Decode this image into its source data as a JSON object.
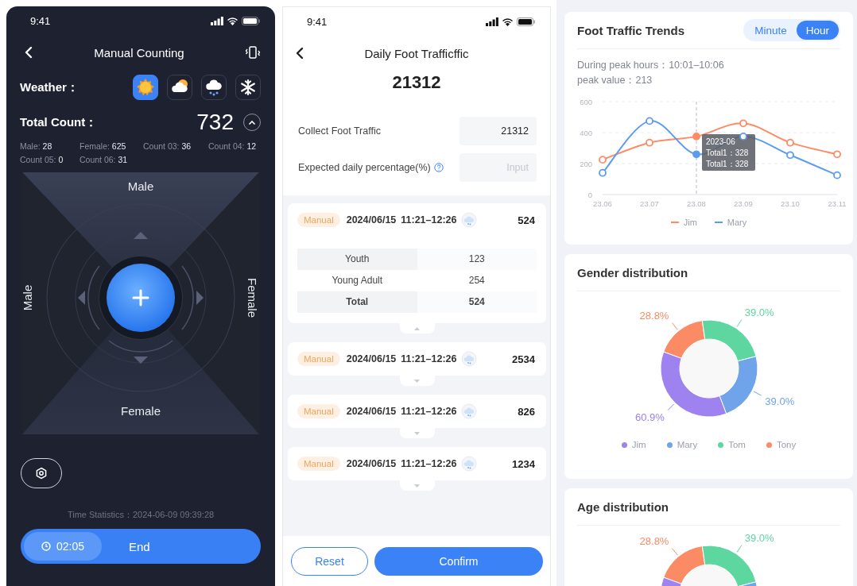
{
  "counting_screen": {
    "status_bar": {
      "time": "9:41"
    },
    "title": "Manual Counting",
    "weather_label": "Weather：",
    "weather": [
      {
        "kind": "sunny",
        "selected": true
      },
      {
        "kind": "cloudy",
        "selected": false
      },
      {
        "kind": "snow_rain",
        "selected": false
      },
      {
        "kind": "snowflake",
        "selected": false
      }
    ],
    "total_label": "Total Count：",
    "total": "732",
    "expanded": true,
    "counts": [
      "Male: **28**",
      "Female: **625**",
      "Count 03: **36**",
      "Count 04: **12**",
      "Count 05: **0**",
      "Count 06: **31**"
    ],
    "pad": {
      "top": "Male",
      "left": "Male",
      "right": "Female",
      "bottom": "Female"
    },
    "time_statistics": "Time Statistics：2024-06-09  09:39:28",
    "timer": "02:05",
    "end_button": "End"
  },
  "daily_screen": {
    "status_bar": {
      "time": "9:41"
    },
    "title": "Daily Foot Trafficffic",
    "total": "21312",
    "fields": [
      {
        "label": "Collect Foot Traffic",
        "value": "21312",
        "help": false
      },
      {
        "label": "Expected daily percentage(%)",
        "placeholder": "Input",
        "help": true
      }
    ],
    "records": [
      {
        "tag": "Manual",
        "date": "2024/06/15",
        "time": "11:21–12:26",
        "count": "524",
        "expanded": true,
        "details": [
          {
            "kind": "row",
            "label": "Youth",
            "value": "123"
          },
          {
            "kind": "row",
            "label": "Young Adult",
            "value": "254"
          },
          {
            "kind": "total",
            "label": "Total",
            "value": "524"
          }
        ]
      },
      {
        "tag": "Manual",
        "date": "2024/06/15",
        "time": "11:21–12:26",
        "count": "2534",
        "expanded": false
      },
      {
        "tag": "Manual",
        "date": "2024/06/15",
        "time": "11:21–12:26",
        "count": "826",
        "expanded": false
      },
      {
        "tag": "Manual",
        "date": "2024/06/15",
        "time": "11:21–12:26",
        "count": "1234",
        "expanded": false
      }
    ],
    "buttons": [
      {
        "kind": "outline",
        "label": "Reset"
      },
      {
        "kind": "primary",
        "label": "Confirm"
      }
    ]
  },
  "dashboard": {
    "trend_card": {
      "title": "Foot Traffic Trends",
      "segments": [
        {
          "label": "Minute",
          "selected": false
        },
        {
          "label": "Hour",
          "selected": true
        }
      ],
      "peak_hours": "During peak hours：10:01–10:06",
      "peak_value": "peak value：213",
      "chart_data": {
        "type": "line",
        "x": [
          "23.06",
          "23.07",
          "23.08",
          "23.09",
          "23.10",
          "23.11"
        ],
        "ylim": [
          0,
          600
        ],
        "yticks": [
          0,
          200,
          400,
          600
        ],
        "series": [
          {
            "name": "Jim",
            "color": "#ff8a65",
            "marker": "circle",
            "values": [
              225,
              335,
              375,
              460,
              335,
              260
            ]
          },
          {
            "name": "Mary",
            "color": "#5b9cf0",
            "marker": "circle",
            "values": [
              140,
              475,
              260,
              375,
              255,
              125
            ]
          }
        ],
        "ref_lines": [
          {
            "axis": "x",
            "value": "23.08"
          }
        ],
        "annotations": [
          {
            "x": "23.08",
            "text": [
              "2023-06",
              "Total1：328",
              "Total1：328"
            ]
          }
        ]
      }
    },
    "gender_card": {
      "title": "Gender distribution",
      "chart_data": {
        "type": "donut",
        "categories": [
          "Jim",
          "Mary",
          "Tom",
          "Tony"
        ],
        "values": [
          60.9,
          39.0,
          39.0,
          28.8
        ],
        "colors": [
          "#9d82f0",
          "#6fa3ea",
          "#5dd6a0",
          "#fb8b64"
        ],
        "value_labels": [
          "60.9%",
          "39.0%",
          "39.0%",
          "28.8%"
        ]
      }
    },
    "age_card": {
      "title": "Age distribution",
      "chart_data": {
        "type": "donut",
        "values": [
          60.9,
          39.0,
          39.0,
          28.8
        ],
        "colors": [
          "#9d82f0",
          "#6fa3ea",
          "#5dd6a0",
          "#fb8b64"
        ],
        "value_labels": [
          null,
          null,
          "39.0%",
          "28.8%"
        ]
      }
    }
  }
}
